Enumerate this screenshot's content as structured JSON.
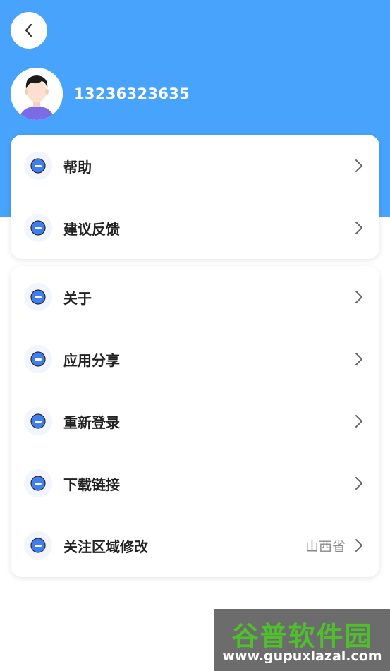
{
  "header": {
    "phone": "13236323635",
    "accent_color": "#47a3fb"
  },
  "group1": [
    {
      "label": "帮助",
      "icon": "info-icon"
    },
    {
      "label": "建议反馈",
      "icon": "info-icon"
    }
  ],
  "group2": [
    {
      "label": "关于",
      "icon": "info-icon"
    },
    {
      "label": "应用分享",
      "icon": "info-icon"
    },
    {
      "label": "重新登录",
      "icon": "info-icon"
    },
    {
      "label": "下载链接",
      "icon": "info-icon"
    },
    {
      "label": "关注区域修改",
      "icon": "info-icon",
      "value": "山西省"
    }
  ],
  "watermark": {
    "title": "谷普软件园",
    "url": "www.gupuxlazal.com"
  }
}
